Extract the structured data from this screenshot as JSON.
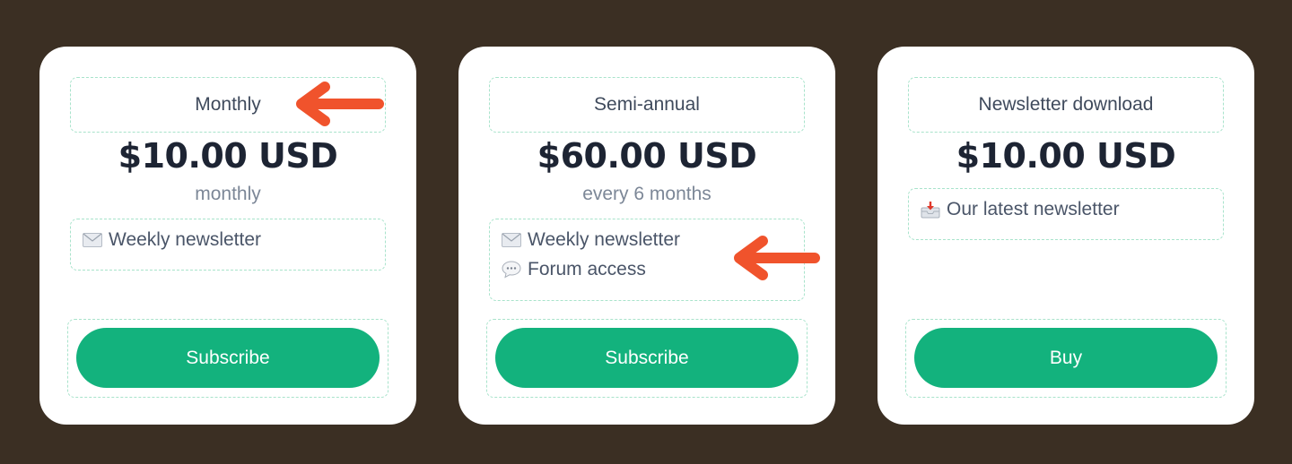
{
  "plans": [
    {
      "name": "Monthly",
      "price": "$10.00 USD",
      "period": "monthly",
      "features": [
        {
          "icon": "envelope-icon",
          "label": "Weekly newsletter"
        }
      ],
      "button_label": "Subscribe"
    },
    {
      "name": "Semi-annual",
      "price": "$60.00 USD",
      "period": "every 6 months",
      "features": [
        {
          "icon": "envelope-icon",
          "label": "Weekly newsletter"
        },
        {
          "icon": "speech-bubble-icon",
          "label": "Forum access"
        }
      ],
      "button_label": "Subscribe"
    },
    {
      "name": "Newsletter download",
      "price": "$10.00 USD",
      "features": [
        {
          "icon": "inbox-tray-icon",
          "label": "Our latest newsletter"
        }
      ],
      "button_label": "Buy"
    }
  ],
  "colors": {
    "background": "#3b2f23",
    "card": "#ffffff",
    "button": "#13b27d",
    "dashed_outline": "#a8e3cb",
    "annotation_arrow": "#f0532c"
  }
}
